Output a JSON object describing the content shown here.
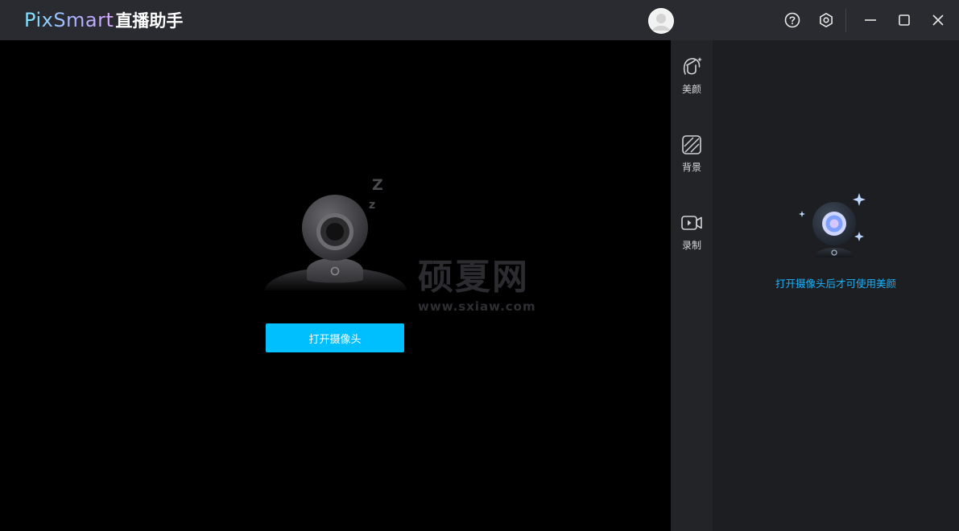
{
  "app": {
    "name_en": "PixSmart",
    "name_cn": "直播助手"
  },
  "titlebar": {
    "icons": [
      "avatar",
      "help-icon",
      "settings-icon",
      "minimize-icon",
      "maximize-icon",
      "close-icon"
    ]
  },
  "stage": {
    "open_camera_label": "打开摄像头",
    "graphic_icon": "sleeping-webcam-icon",
    "watermark_cn": "硕夏网",
    "watermark_url": "www.sxiaw.com"
  },
  "toolstrip": {
    "items": [
      {
        "label": "美颜",
        "icon": "beauty-face-icon"
      },
      {
        "label": "背景",
        "icon": "background-icon"
      },
      {
        "label": "录制",
        "icon": "record-video-icon"
      }
    ]
  },
  "panel": {
    "hint": "打开摄像头后才可使用美颜",
    "graphic_icon": "sparkle-webcam-icon"
  },
  "colors": {
    "accent": "#00bfff",
    "hint": "#18b4ff",
    "titlebar": "#2a2b30",
    "toolstrip": "#232428",
    "panel": "#1d1e22"
  }
}
